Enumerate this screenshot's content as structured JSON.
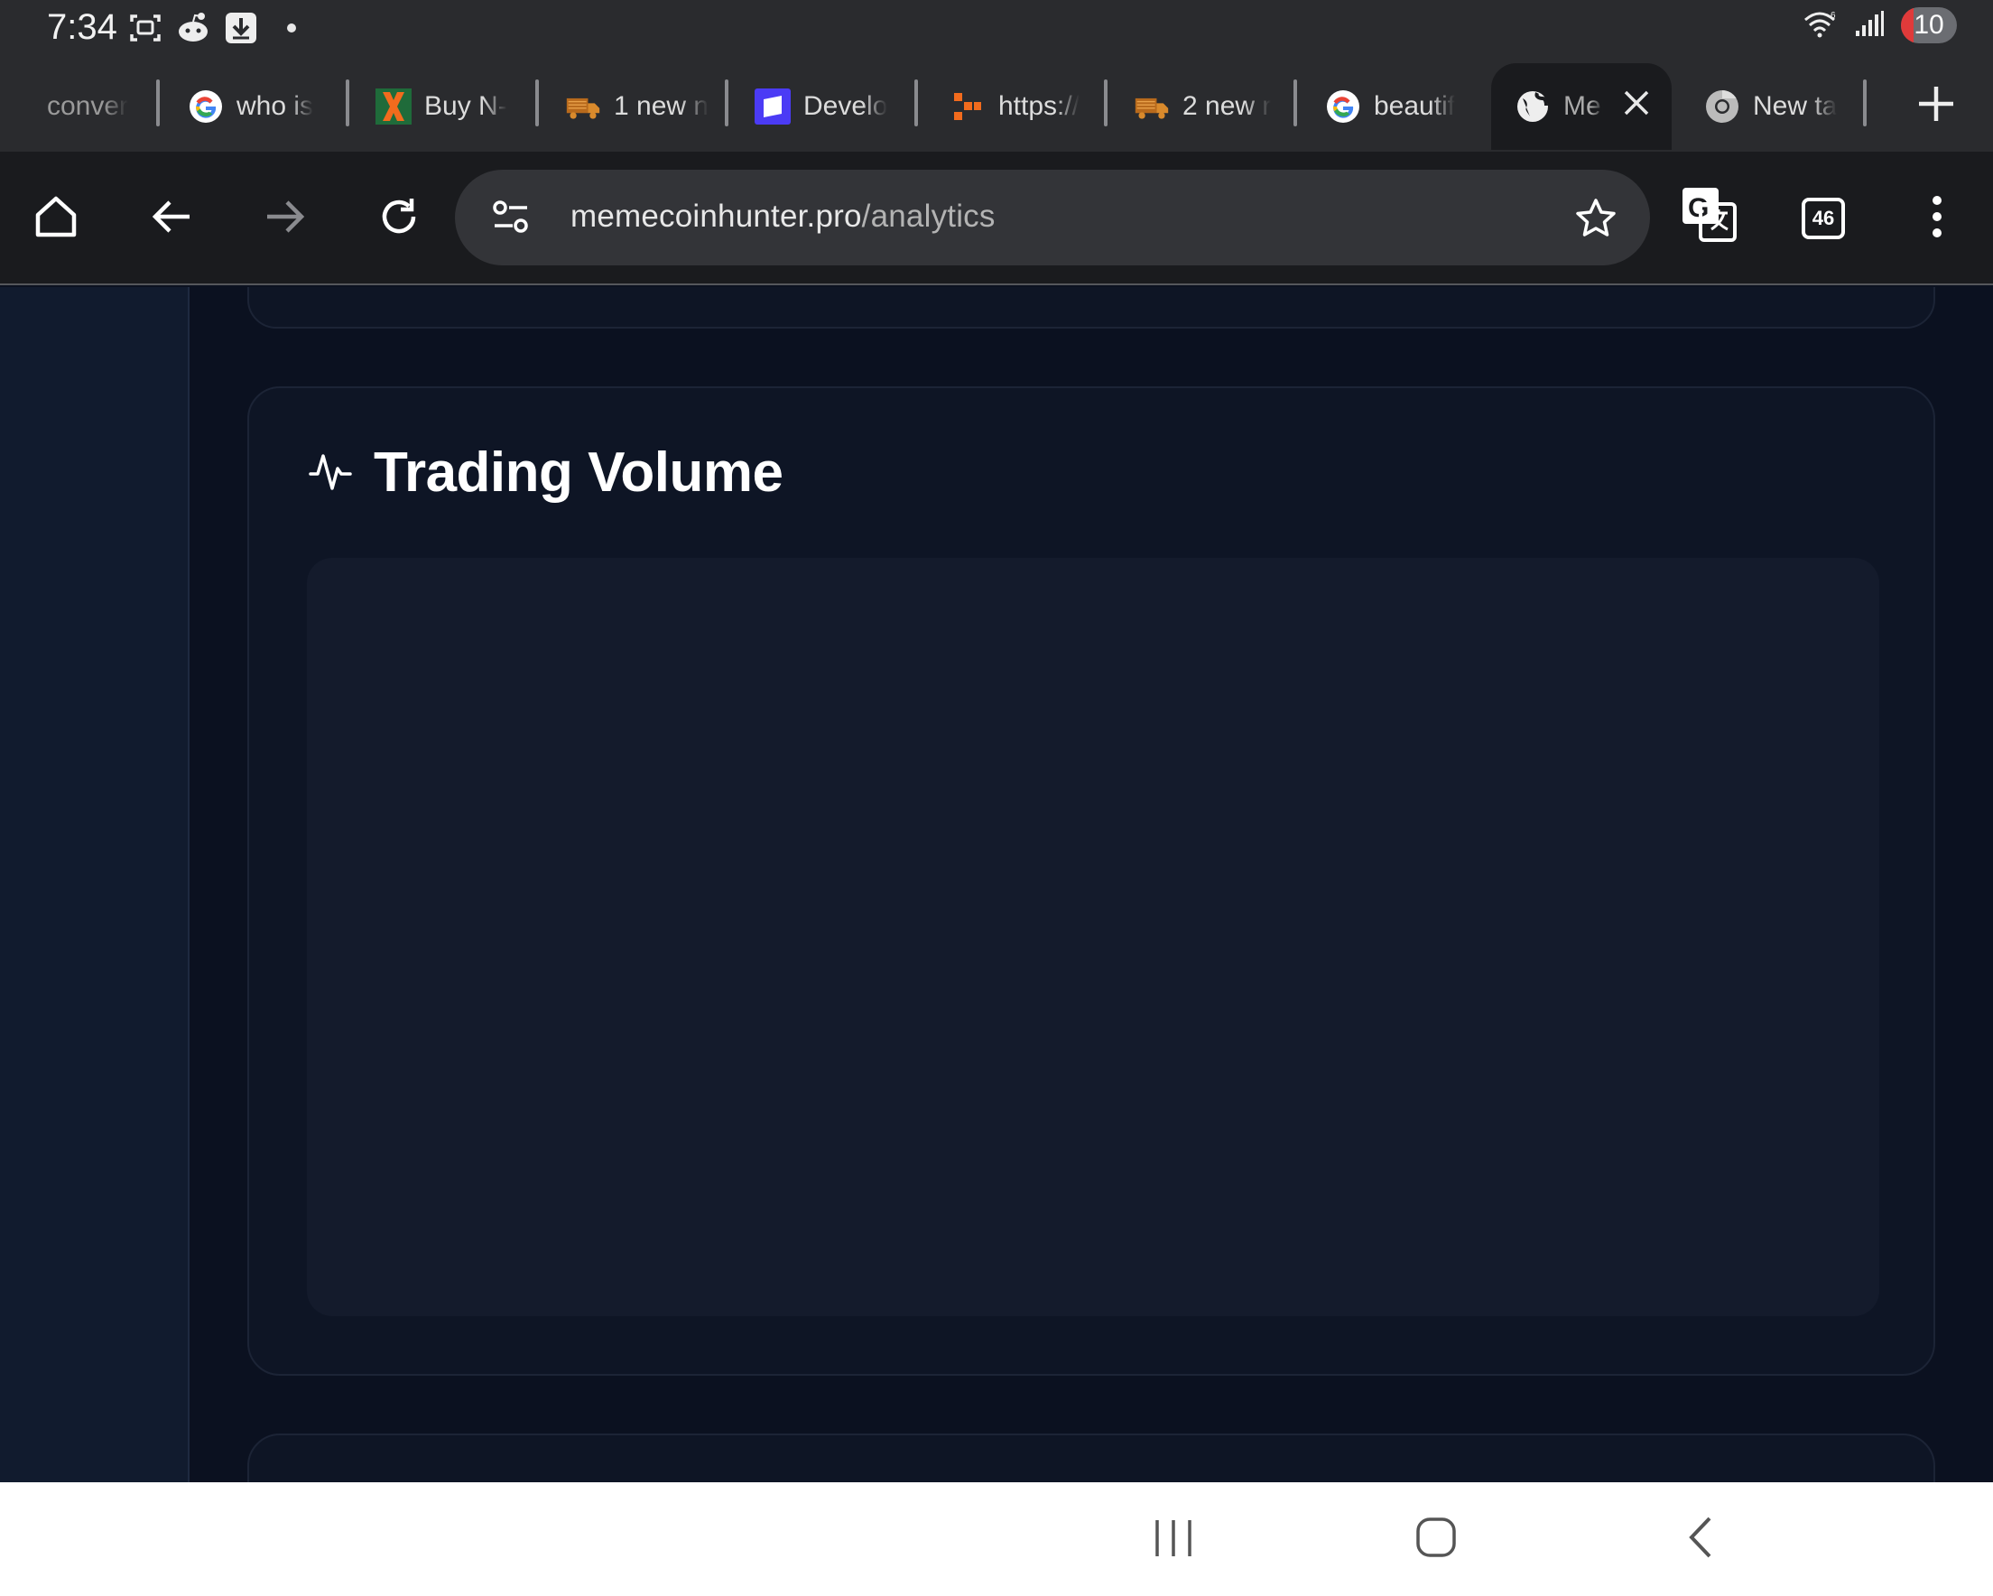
{
  "status_bar": {
    "time": "7:34",
    "battery_level": "10",
    "left_icons": [
      "screenshot-icon",
      "reddit-icon",
      "download-icon"
    ],
    "right_icons": [
      "wifi-icon",
      "signal-icon"
    ]
  },
  "tabs": [
    {
      "label": "conver",
      "favicon": "none"
    },
    {
      "label": "who is",
      "favicon": "google-icon"
    },
    {
      "label": "Buy N-",
      "favicon": "x-logo-icon"
    },
    {
      "label": "1 new n",
      "favicon": "truck-icon"
    },
    {
      "label": "Develo",
      "favicon": "purple-square-icon"
    },
    {
      "label": "https://",
      "favicon": "orange-dots-icon"
    },
    {
      "label": "2 new r",
      "favicon": "truck-icon"
    },
    {
      "label": "beautif",
      "favicon": "google-icon"
    },
    {
      "label": "Mer",
      "favicon": "globe-icon",
      "active": true
    },
    {
      "label": "New ta",
      "favicon": "chrome-icon"
    }
  ],
  "toolbar": {
    "url_host": "memecoinhunter.pro",
    "url_path": "/analytics",
    "tab_count": "46"
  },
  "main": {
    "card_title": "Trading Volume"
  },
  "colors": {
    "page_bg": "#0b1120",
    "card_bg": "#0e1525",
    "chart_bg": "#141b2c",
    "sidebar_bg": "#111b2e",
    "browser_chrome": "#2a2b2e"
  }
}
